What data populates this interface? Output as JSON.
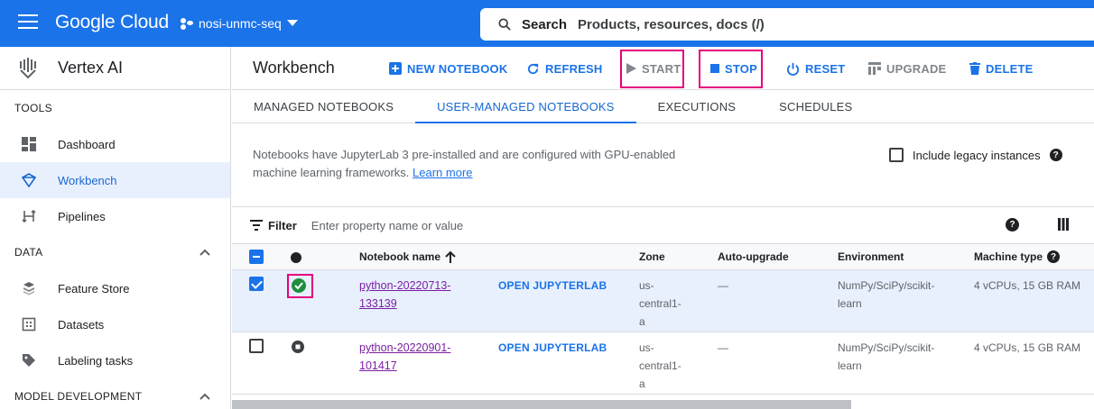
{
  "topbar": {
    "logo": "Google Cloud",
    "project": "nosi-unmc-seq",
    "search_label": "Search",
    "search_placeholder": "Products, resources, docs (/)"
  },
  "sidebar": {
    "product": "Vertex AI",
    "sections": {
      "tools": "TOOLS",
      "data": "DATA",
      "model_dev": "MODEL DEVELOPMENT"
    },
    "tools_items": [
      {
        "label": "Dashboard",
        "icon": "dashboard-icon"
      },
      {
        "label": "Workbench",
        "icon": "workbench-icon",
        "active": true
      },
      {
        "label": "Pipelines",
        "icon": "pipelines-icon"
      }
    ],
    "data_items": [
      {
        "label": "Feature Store",
        "icon": "feature-store-icon"
      },
      {
        "label": "Datasets",
        "icon": "datasets-icon"
      },
      {
        "label": "Labeling tasks",
        "icon": "label-icon"
      }
    ]
  },
  "main": {
    "title": "Workbench",
    "actions": {
      "new_notebook": "NEW NOTEBOOK",
      "refresh": "REFRESH",
      "start": "START",
      "stop": "STOP",
      "reset": "RESET",
      "upgrade": "UPGRADE",
      "delete": "DELETE"
    },
    "tabs": [
      "MANAGED NOTEBOOKS",
      "USER-MANAGED NOTEBOOKS",
      "EXECUTIONS",
      "SCHEDULES"
    ],
    "info_line1": "Notebooks have JupyterLab 3 pre-installed and are configured with GPU-enabled",
    "info_line2": "machine learning frameworks.",
    "learn_more": "Learn more",
    "legacy_label": "Include legacy instances",
    "filter_label": "Filter",
    "filter_placeholder": "Enter property name or value",
    "columns": {
      "name": "Notebook name",
      "zone": "Zone",
      "auto_upgrade": "Auto-upgrade",
      "environment": "Environment",
      "machine_type": "Machine type"
    },
    "rows": [
      {
        "name_l1": "python-20220713-",
        "name_l2": "133139",
        "open": "OPEN JUPYTERLAB",
        "zone_l1": "us-",
        "zone_l2": "central1-",
        "zone_l3": "a",
        "auto_upgrade": "—",
        "env_l1": "NumPy/SciPy/scikit-",
        "env_l2": "learn",
        "machine": "4 vCPUs, 15 GB RAM",
        "selected": true,
        "status": "running"
      },
      {
        "name_l1": "python-20220901-",
        "name_l2": "101417",
        "open": "OPEN JUPYTERLAB",
        "zone_l1": "us-",
        "zone_l2": "central1-",
        "zone_l3": "a",
        "auto_upgrade": "—",
        "env_l1": "NumPy/SciPy/scikit-",
        "env_l2": "learn",
        "machine": "4 vCPUs, 15 GB RAM",
        "selected": false,
        "status": "stopped"
      }
    ]
  },
  "colors": {
    "brand_blue": "#1a73e8",
    "highlight_pink": "#e6007e",
    "running_green": "#1e8e3e"
  }
}
